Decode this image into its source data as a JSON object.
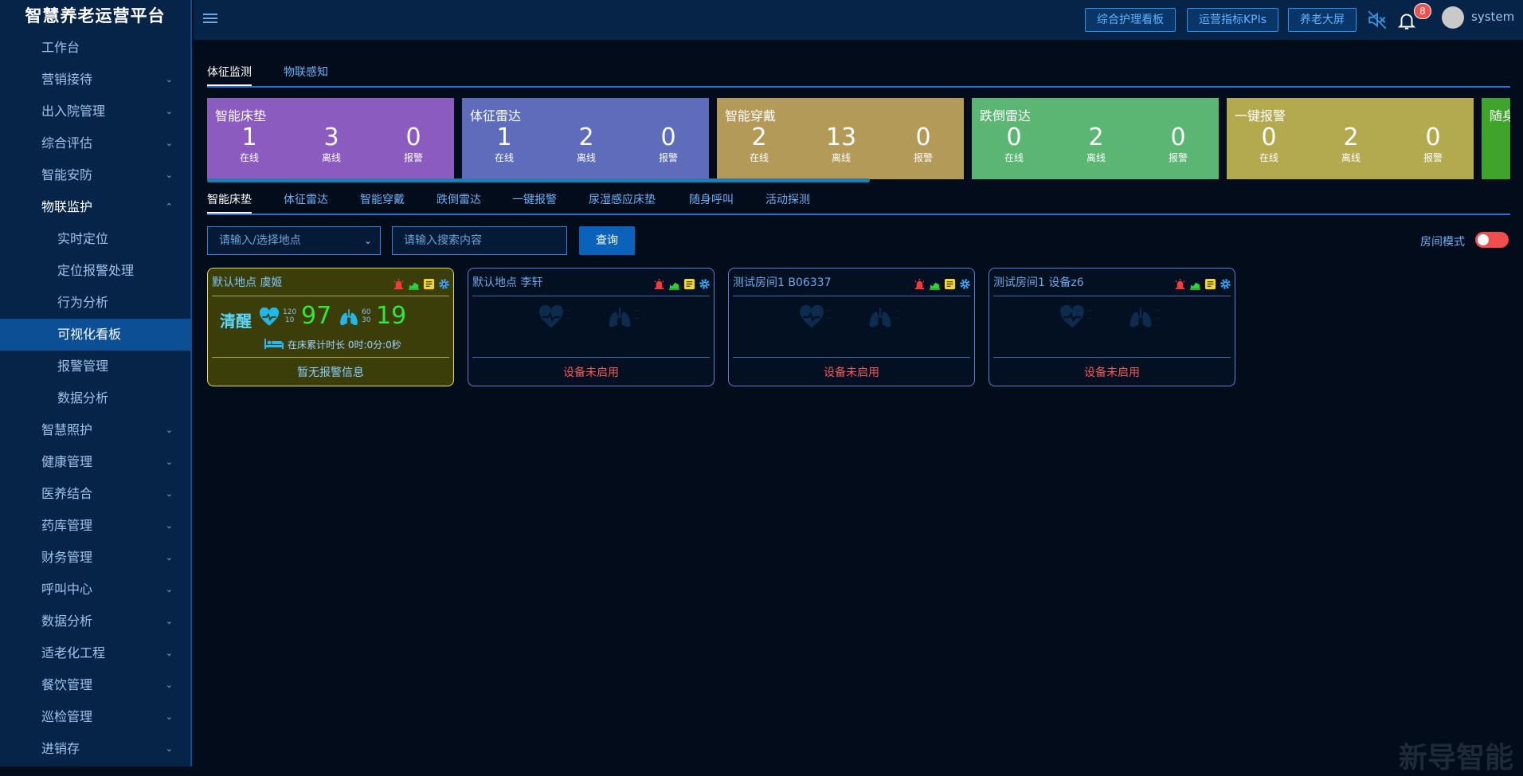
{
  "app": {
    "title": "智慧养老运营平台"
  },
  "sidebar": {
    "items": [
      {
        "label": "工作台",
        "level": 1,
        "has_children": false
      },
      {
        "label": "营销接待",
        "level": 1,
        "has_children": true
      },
      {
        "label": "出入院管理",
        "level": 1,
        "has_children": true
      },
      {
        "label": "综合评估",
        "level": 1,
        "has_children": true
      },
      {
        "label": "智能安防",
        "level": 1,
        "has_children": true
      },
      {
        "label": "物联监护",
        "level": 1,
        "has_children": true,
        "expanded": true
      },
      {
        "label": "实时定位",
        "level": 2
      },
      {
        "label": "定位报警处理",
        "level": 2
      },
      {
        "label": "行为分析",
        "level": 2
      },
      {
        "label": "可视化看板",
        "level": 2,
        "active": true
      },
      {
        "label": "报警管理",
        "level": 2
      },
      {
        "label": "数据分析",
        "level": 2
      },
      {
        "label": "智慧照护",
        "level": 1,
        "has_children": true
      },
      {
        "label": "健康管理",
        "level": 1,
        "has_children": true
      },
      {
        "label": "医养结合",
        "level": 1,
        "has_children": true
      },
      {
        "label": "药库管理",
        "level": 1,
        "has_children": true
      },
      {
        "label": "财务管理",
        "level": 1,
        "has_children": true
      },
      {
        "label": "呼叫中心",
        "level": 1,
        "has_children": true
      },
      {
        "label": "数据分析",
        "level": 1,
        "has_children": true
      },
      {
        "label": "适老化工程",
        "level": 1,
        "has_children": true
      },
      {
        "label": "餐饮管理",
        "level": 1,
        "has_children": true
      },
      {
        "label": "巡检管理",
        "level": 1,
        "has_children": true
      },
      {
        "label": "进销存",
        "level": 1,
        "has_children": true
      }
    ]
  },
  "topbar": {
    "buttons": [
      "综合护理看板",
      "运营指标KPIs",
      "养老大屏"
    ],
    "notification_count": "8",
    "username": "system"
  },
  "main": {
    "top_tabs": [
      {
        "label": "体征监测",
        "active": true
      },
      {
        "label": "物联感知",
        "active": false
      }
    ],
    "device_cards": [
      {
        "title": "智能床垫",
        "color": "#8b5bbf",
        "stats": [
          {
            "value": "1",
            "label": "在线"
          },
          {
            "value": "3",
            "label": "离线"
          },
          {
            "value": "0",
            "label": "报警"
          }
        ]
      },
      {
        "title": "体征雷达",
        "color": "#5d6dbc",
        "stats": [
          {
            "value": "1",
            "label": "在线"
          },
          {
            "value": "2",
            "label": "离线"
          },
          {
            "value": "0",
            "label": "报警"
          }
        ]
      },
      {
        "title": "智能穿戴",
        "color": "#b49a58",
        "stats": [
          {
            "value": "2",
            "label": "在线"
          },
          {
            "value": "13",
            "label": "离线"
          },
          {
            "value": "0",
            "label": "报警"
          }
        ]
      },
      {
        "title": "跌倒雷达",
        "color": "#5ab672",
        "stats": [
          {
            "value": "0",
            "label": "在线"
          },
          {
            "value": "2",
            "label": "离线"
          },
          {
            "value": "0",
            "label": "报警"
          }
        ]
      },
      {
        "title": "一键报警",
        "color": "#b3aa50",
        "stats": [
          {
            "value": "0",
            "label": "在线"
          },
          {
            "value": "2",
            "label": "离线"
          },
          {
            "value": "0",
            "label": "报警"
          }
        ]
      },
      {
        "title": "随身",
        "color": "#3fa42c",
        "stats": []
      }
    ],
    "sub_tabs": [
      {
        "label": "智能床垫",
        "active": true
      },
      {
        "label": "体征雷达"
      },
      {
        "label": "智能穿戴"
      },
      {
        "label": "跌倒雷达"
      },
      {
        "label": "一键报警"
      },
      {
        "label": "尿湿感应床垫"
      },
      {
        "label": "随身呼叫"
      },
      {
        "label": "活动探测"
      }
    ],
    "filters": {
      "location_placeholder": "请输入/选择地点",
      "search_placeholder": "请输入搜索内容",
      "query_label": "查询",
      "room_mode_label": "房间模式",
      "room_mode_on": false
    },
    "bed_cards": [
      {
        "title": "默认地点  虞姬",
        "alert": true,
        "status": "清醒",
        "heart_range": [
          "120",
          "10"
        ],
        "heart_rate": "97",
        "breath_range": [
          "60",
          "30"
        ],
        "breath_rate": "19",
        "bed_time": "在床累计时长 0时:0分:0秒",
        "footer": "暂无报警信息"
      },
      {
        "title": "默认地点  李轩",
        "alert": false,
        "footer": "设备未启用"
      },
      {
        "title": "测试房间1  B06337",
        "alert": false,
        "footer": "设备未启用"
      },
      {
        "title": "测试房间1  设备z6",
        "alert": false,
        "footer": "设备未启用"
      }
    ]
  },
  "colors": {
    "sidebar_bg": "#062447",
    "page_bg": "#020c1b",
    "accent": "#2c8fe8",
    "alert_red": "#f05a5a",
    "value_green": "#33e63a"
  }
}
